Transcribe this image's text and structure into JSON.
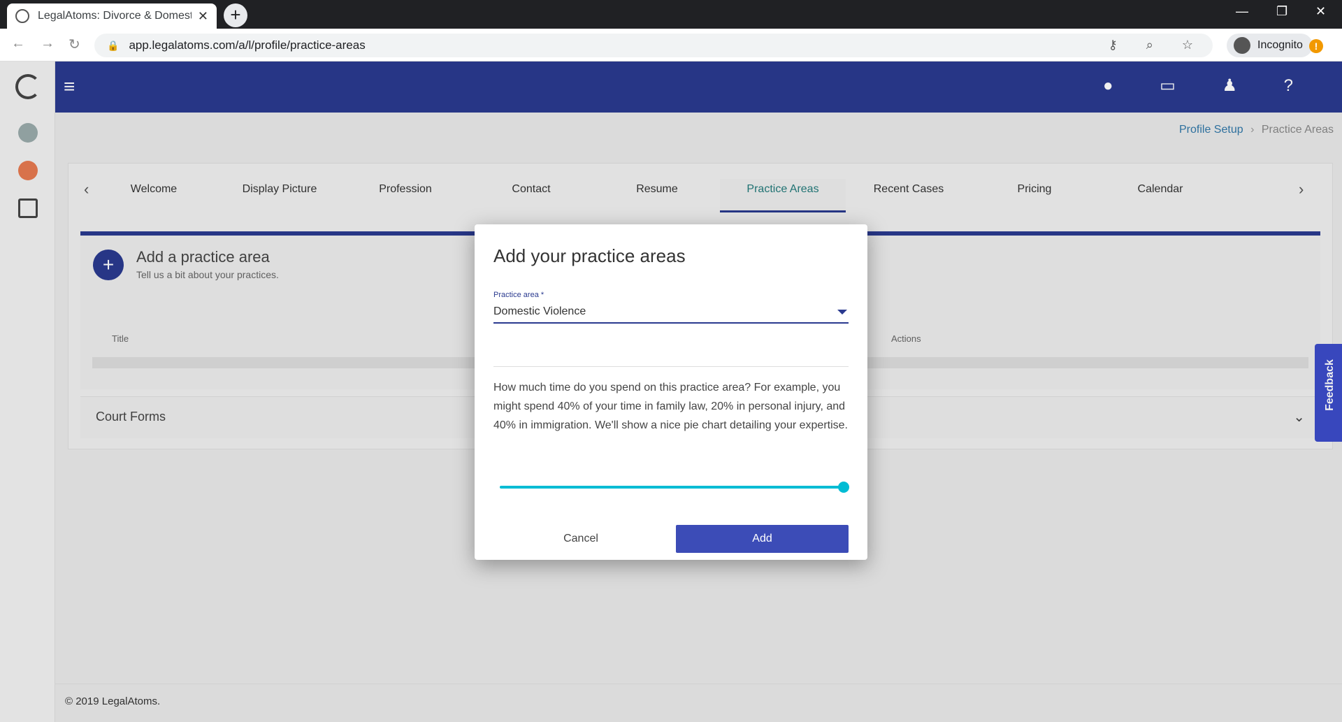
{
  "browser": {
    "tab_title": "LegalAtoms: Divorce & Domestic",
    "url": "app.legalatoms.com/a/l/profile/practice-areas",
    "incognito_label": "Incognito"
  },
  "breadcrumb": {
    "parent": "Profile Setup",
    "current": "Practice Areas"
  },
  "steps": [
    "Welcome",
    "Display Picture",
    "Profession",
    "Contact",
    "Resume",
    "Practice Areas",
    "Recent Cases",
    "Pricing",
    "Calendar"
  ],
  "active_step": "Practice Areas",
  "add_panel": {
    "title": "Add a practice area",
    "subtitle": "Tell us a bit about your practices.",
    "col_title": "Title",
    "col_actions": "Actions"
  },
  "court_forms": "Court Forms",
  "footer": "© 2019 LegalAtoms.",
  "feedback": "Feedback",
  "modal": {
    "title": "Add your practice areas",
    "field_label": "Practice area *",
    "field_value": "Domestic Violence",
    "description": "How much time do you spend on this practice area? For example, you might spend 40% of your time in family law, 20% in personal injury, and 40% in immigration. We'll show a nice pie chart detailing your expertise.",
    "slider_fraction": 1.0,
    "cancel": "Cancel",
    "add": "Add"
  }
}
